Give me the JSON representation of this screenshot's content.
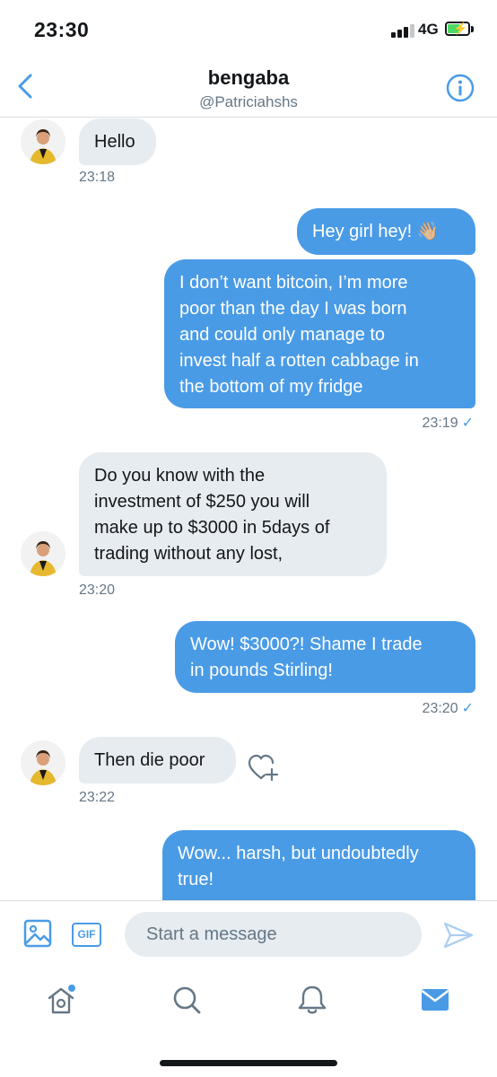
{
  "status": {
    "time": "23:30",
    "network": "4G"
  },
  "header": {
    "name": "bengaba",
    "handle": "@Patriciahshs"
  },
  "messages": [
    {
      "text": "Hello",
      "time": "23:18"
    },
    {
      "text": "Hey girl hey! 👋🏼"
    },
    {
      "text": "I don’t want bitcoin, I’m more\npoor than the day I was born\nand could only manage to\ninvest half a rotten cabbage in\nthe bottom of my fridge",
      "time": "23:19",
      "check": "✓"
    },
    {
      "text": "Do you know with the\ninvestment of $250 you will\nmake up to $3000 in 5days of\ntrading without any lost,",
      "time": "23:20"
    },
    {
      "text": "Wow! $3000?! Shame I trade\nin pounds Stirling!",
      "time": "23:20",
      "check": "✓"
    },
    {
      "text": "Then die poor",
      "time": "23:22"
    },
    {
      "text": "Wow... harsh, but undoubtedly\ntrue!"
    }
  ],
  "compose": {
    "gif_label": "GIF",
    "placeholder": "Start a message"
  },
  "colors": {
    "accent": "#4a9be6",
    "incoming_bubble": "#e6ecf0",
    "secondary_text": "#657786"
  },
  "icons": [
    "back-chevron-icon",
    "info-icon",
    "media-icon",
    "gif-icon",
    "send-icon",
    "home-icon",
    "search-icon",
    "notifications-icon",
    "messages-icon",
    "heart-plus-icon"
  ]
}
